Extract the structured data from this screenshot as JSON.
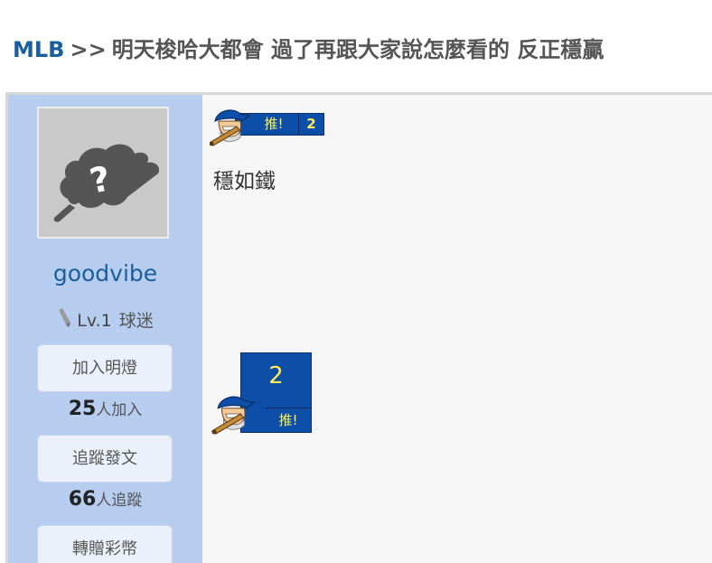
{
  "breadcrumb": {
    "board": "MLB",
    "separator": ">>",
    "title": "明天梭哈大都會 過了再跟大家說怎麼看的 反正穩贏"
  },
  "user": {
    "name": "goodvibe",
    "level": "Lv.1",
    "rank": "球迷",
    "follow_light_button": "加入明燈",
    "light_count": "25",
    "light_count_suffix": "人加入",
    "track_button": "追蹤發文",
    "track_count": "66",
    "track_count_suffix": "人追蹤",
    "gift_button": "轉贈彩幣"
  },
  "post": {
    "push_label": "推!",
    "push_count": "2",
    "text": "穩如鐵",
    "push_big_count": "2",
    "push_big_label": "推!"
  },
  "colors": {
    "sidebar": "#b6cdf0",
    "link": "#1a5f9c",
    "push_badge": "#0d4fa8",
    "push_text": "#ffee55"
  },
  "icons": {
    "avatar": "unknown-user-silhouette",
    "level": "pencil-icon",
    "push": "baseball-mascot-icon"
  }
}
